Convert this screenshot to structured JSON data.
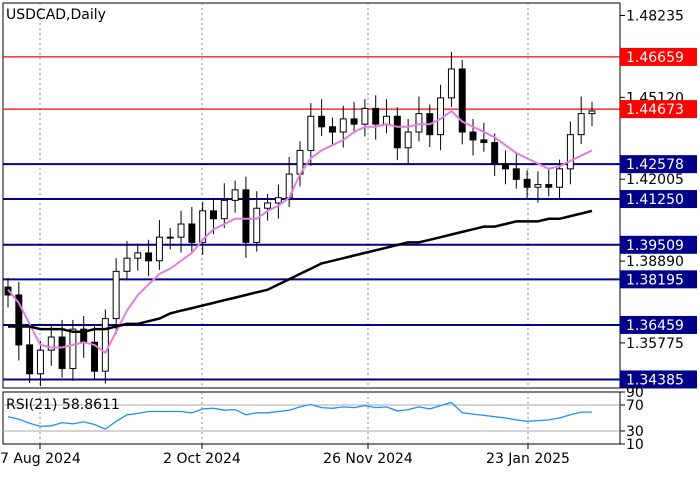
{
  "chart_data": [
    {
      "type": "candlestick",
      "title": "USDCAD,Daily",
      "x_ticks": [
        "7 Aug 2024",
        "2 Oct 2024",
        "26 Nov 2024",
        "23 Jan 2025"
      ],
      "y_ticks": [
        1.48235,
        1.4512,
        1.42005,
        1.3889,
        1.35775
      ],
      "ylim": [
        1.3406,
        1.4871
      ],
      "levels": [
        {
          "value": 1.46659,
          "label": "1.46659",
          "color": "#ff0000"
        },
        {
          "value": 1.44673,
          "label": "1.44673",
          "color": "#ff0000"
        },
        {
          "value": 1.42578,
          "label": "1.42578",
          "color": "#00008b"
        },
        {
          "value": 1.4125,
          "label": "1.41250",
          "color": "#00008b"
        },
        {
          "value": 1.39509,
          "label": "1.39509",
          "color": "#00008b"
        },
        {
          "value": 1.38195,
          "label": "1.38195",
          "color": "#00008b"
        },
        {
          "value": 1.36459,
          "label": "1.36459",
          "color": "#00008b"
        },
        {
          "value": 1.34385,
          "label": "1.34385",
          "color": "#00008b"
        }
      ],
      "series": [
        {
          "color": "#000000",
          "values": [
            1.376,
            1.357,
            1.346,
            1.355,
            1.36,
            1.348,
            1.363,
            1.358,
            1.347,
            1.367,
            1.385,
            1.39,
            1.392,
            1.389,
            1.398,
            1.398,
            1.403,
            1.396,
            1.408,
            1.405,
            1.412,
            1.416,
            1.396,
            1.409,
            1.411,
            1.413,
            1.422,
            1.431,
            1.444,
            1.44,
            1.438,
            1.443,
            1.441,
            1.447,
            1.441,
            1.444,
            1.432,
            1.438,
            1.445,
            1.437,
            1.451,
            1.462,
            1.438,
            1.435,
            1.434,
            1.426,
            1.424,
            1.42,
            1.417,
            1.418,
            1.417,
            1.424,
            1.437,
            1.445,
            1.446
          ]
        },
        {
          "color": "#e07fdc",
          "values": [
            1.378,
            1.373,
            1.365,
            1.357,
            1.356,
            1.356,
            1.357,
            1.358,
            1.357,
            1.354,
            1.362,
            1.37,
            1.376,
            1.38,
            1.384,
            1.386,
            1.389,
            1.392,
            1.397,
            1.401,
            1.403,
            1.405,
            1.405,
            1.405,
            1.408,
            1.41,
            1.413,
            1.422,
            1.428,
            1.431,
            1.433,
            1.435,
            1.438,
            1.44,
            1.44,
            1.441,
            1.44,
            1.44,
            1.441,
            1.441,
            1.443,
            1.446,
            1.442,
            1.44,
            1.438,
            1.436,
            1.433,
            1.43,
            1.428,
            1.426,
            1.424,
            1.425,
            1.427,
            1.429,
            1.431
          ]
        },
        {
          "color": "#000000",
          "values": [
            1.364,
            1.364,
            1.364,
            1.363,
            1.363,
            1.363,
            1.362,
            1.362,
            1.363,
            1.363,
            1.364,
            1.365,
            1.365,
            1.366,
            1.367,
            1.369,
            1.37,
            1.371,
            1.372,
            1.373,
            1.374,
            1.375,
            1.376,
            1.377,
            1.378,
            1.38,
            1.382,
            1.384,
            1.386,
            1.388,
            1.389,
            1.39,
            1.391,
            1.392,
            1.393,
            1.394,
            1.395,
            1.396,
            1.396,
            1.397,
            1.398,
            1.399,
            1.4,
            1.401,
            1.402,
            1.402,
            1.403,
            1.404,
            1.404,
            1.404,
            1.405,
            1.405,
            1.406,
            1.407,
            1.408
          ]
        }
      ],
      "grid": true
    },
    {
      "type": "line",
      "title": "RSI(21) 58.8611",
      "y_ticks": [
        90,
        70,
        30,
        10
      ],
      "ylim": [
        10,
        90
      ],
      "levels": [
        70,
        30
      ],
      "series": [
        {
          "color": "#1e90ff",
          "values": [
            52,
            48,
            42,
            37,
            38,
            43,
            41,
            44,
            40,
            33,
            45,
            55,
            57,
            60,
            60,
            60,
            60,
            58,
            64,
            65,
            62,
            63,
            55,
            58,
            58,
            60,
            62,
            67,
            71,
            66,
            65,
            67,
            66,
            69,
            66,
            67,
            61,
            63,
            67,
            64,
            69,
            74,
            58,
            56,
            54,
            52,
            50,
            47,
            45,
            46,
            47,
            50,
            55,
            59,
            59
          ]
        }
      ]
    }
  ]
}
